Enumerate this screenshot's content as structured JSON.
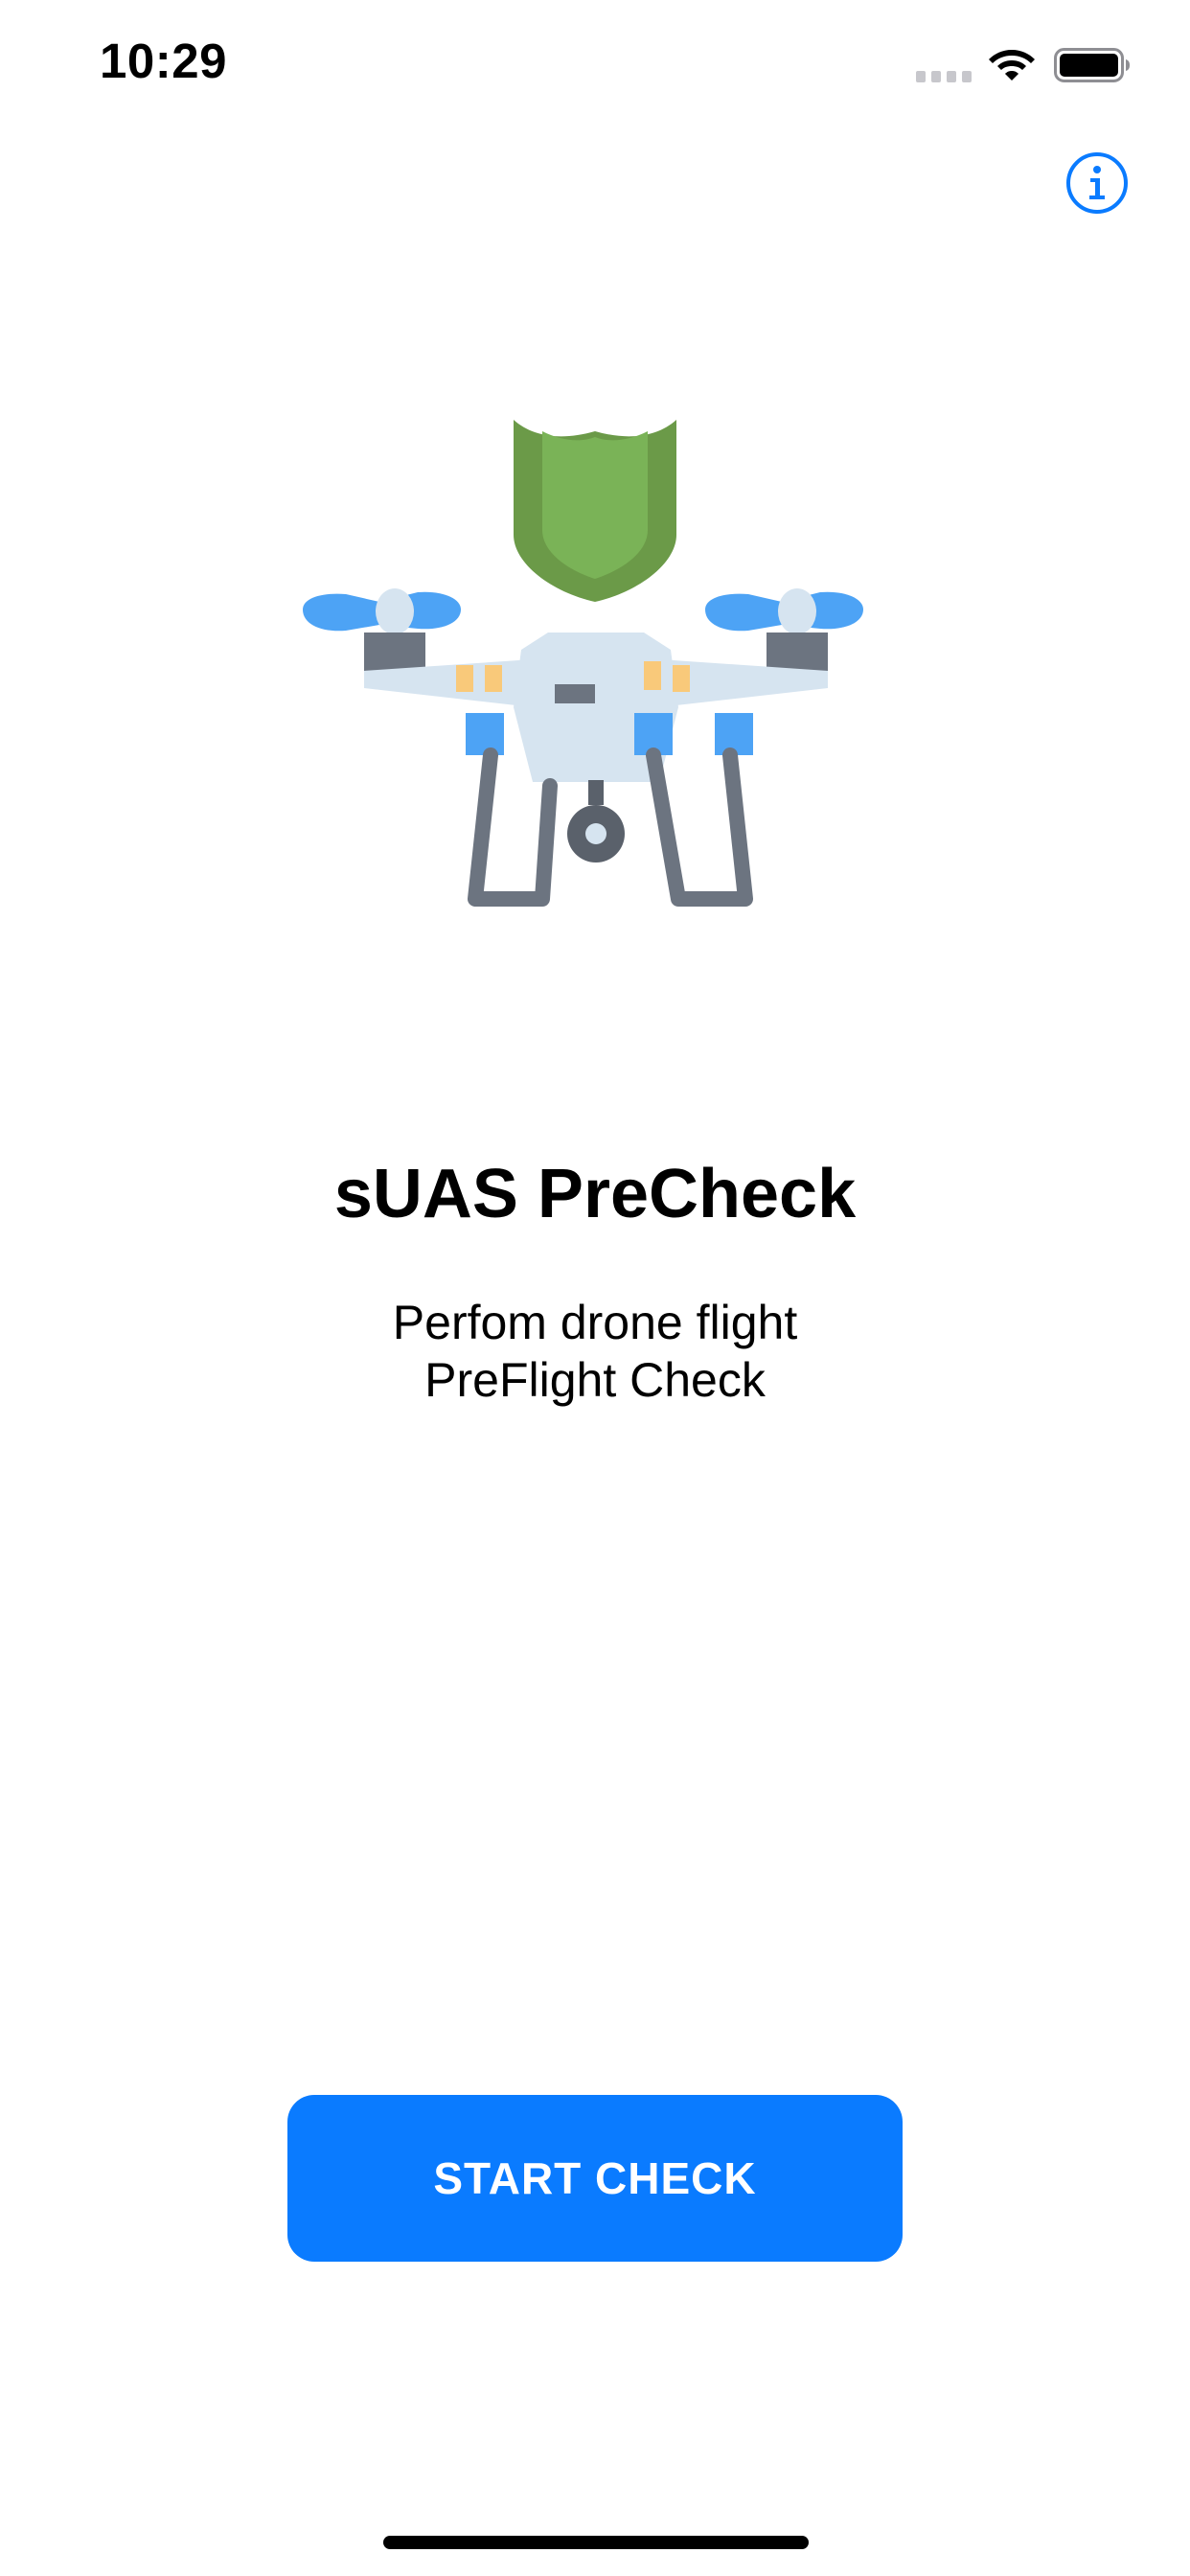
{
  "status_bar": {
    "time": "10:29",
    "icons": [
      "cellular-signal-icon",
      "wifi-icon",
      "battery-icon"
    ]
  },
  "header": {
    "info_icon": "info-icon",
    "accent_color": "#0a7bff"
  },
  "hero": {
    "image": "drone-with-shield-illustration",
    "colors": {
      "shield": "#6b9a48",
      "shield_inner": "#7ab357",
      "propeller": "#4da3f5",
      "body": "#d6e4f0",
      "frame": "#6c7480",
      "accent": "#f9c97a"
    }
  },
  "main": {
    "title": "sUAS PreCheck",
    "subtitle_line1": "Perfom drone flight",
    "subtitle_line2": "PreFlight Check"
  },
  "actions": {
    "start_label": "START CHECK",
    "start_color": "#0a7bff"
  }
}
